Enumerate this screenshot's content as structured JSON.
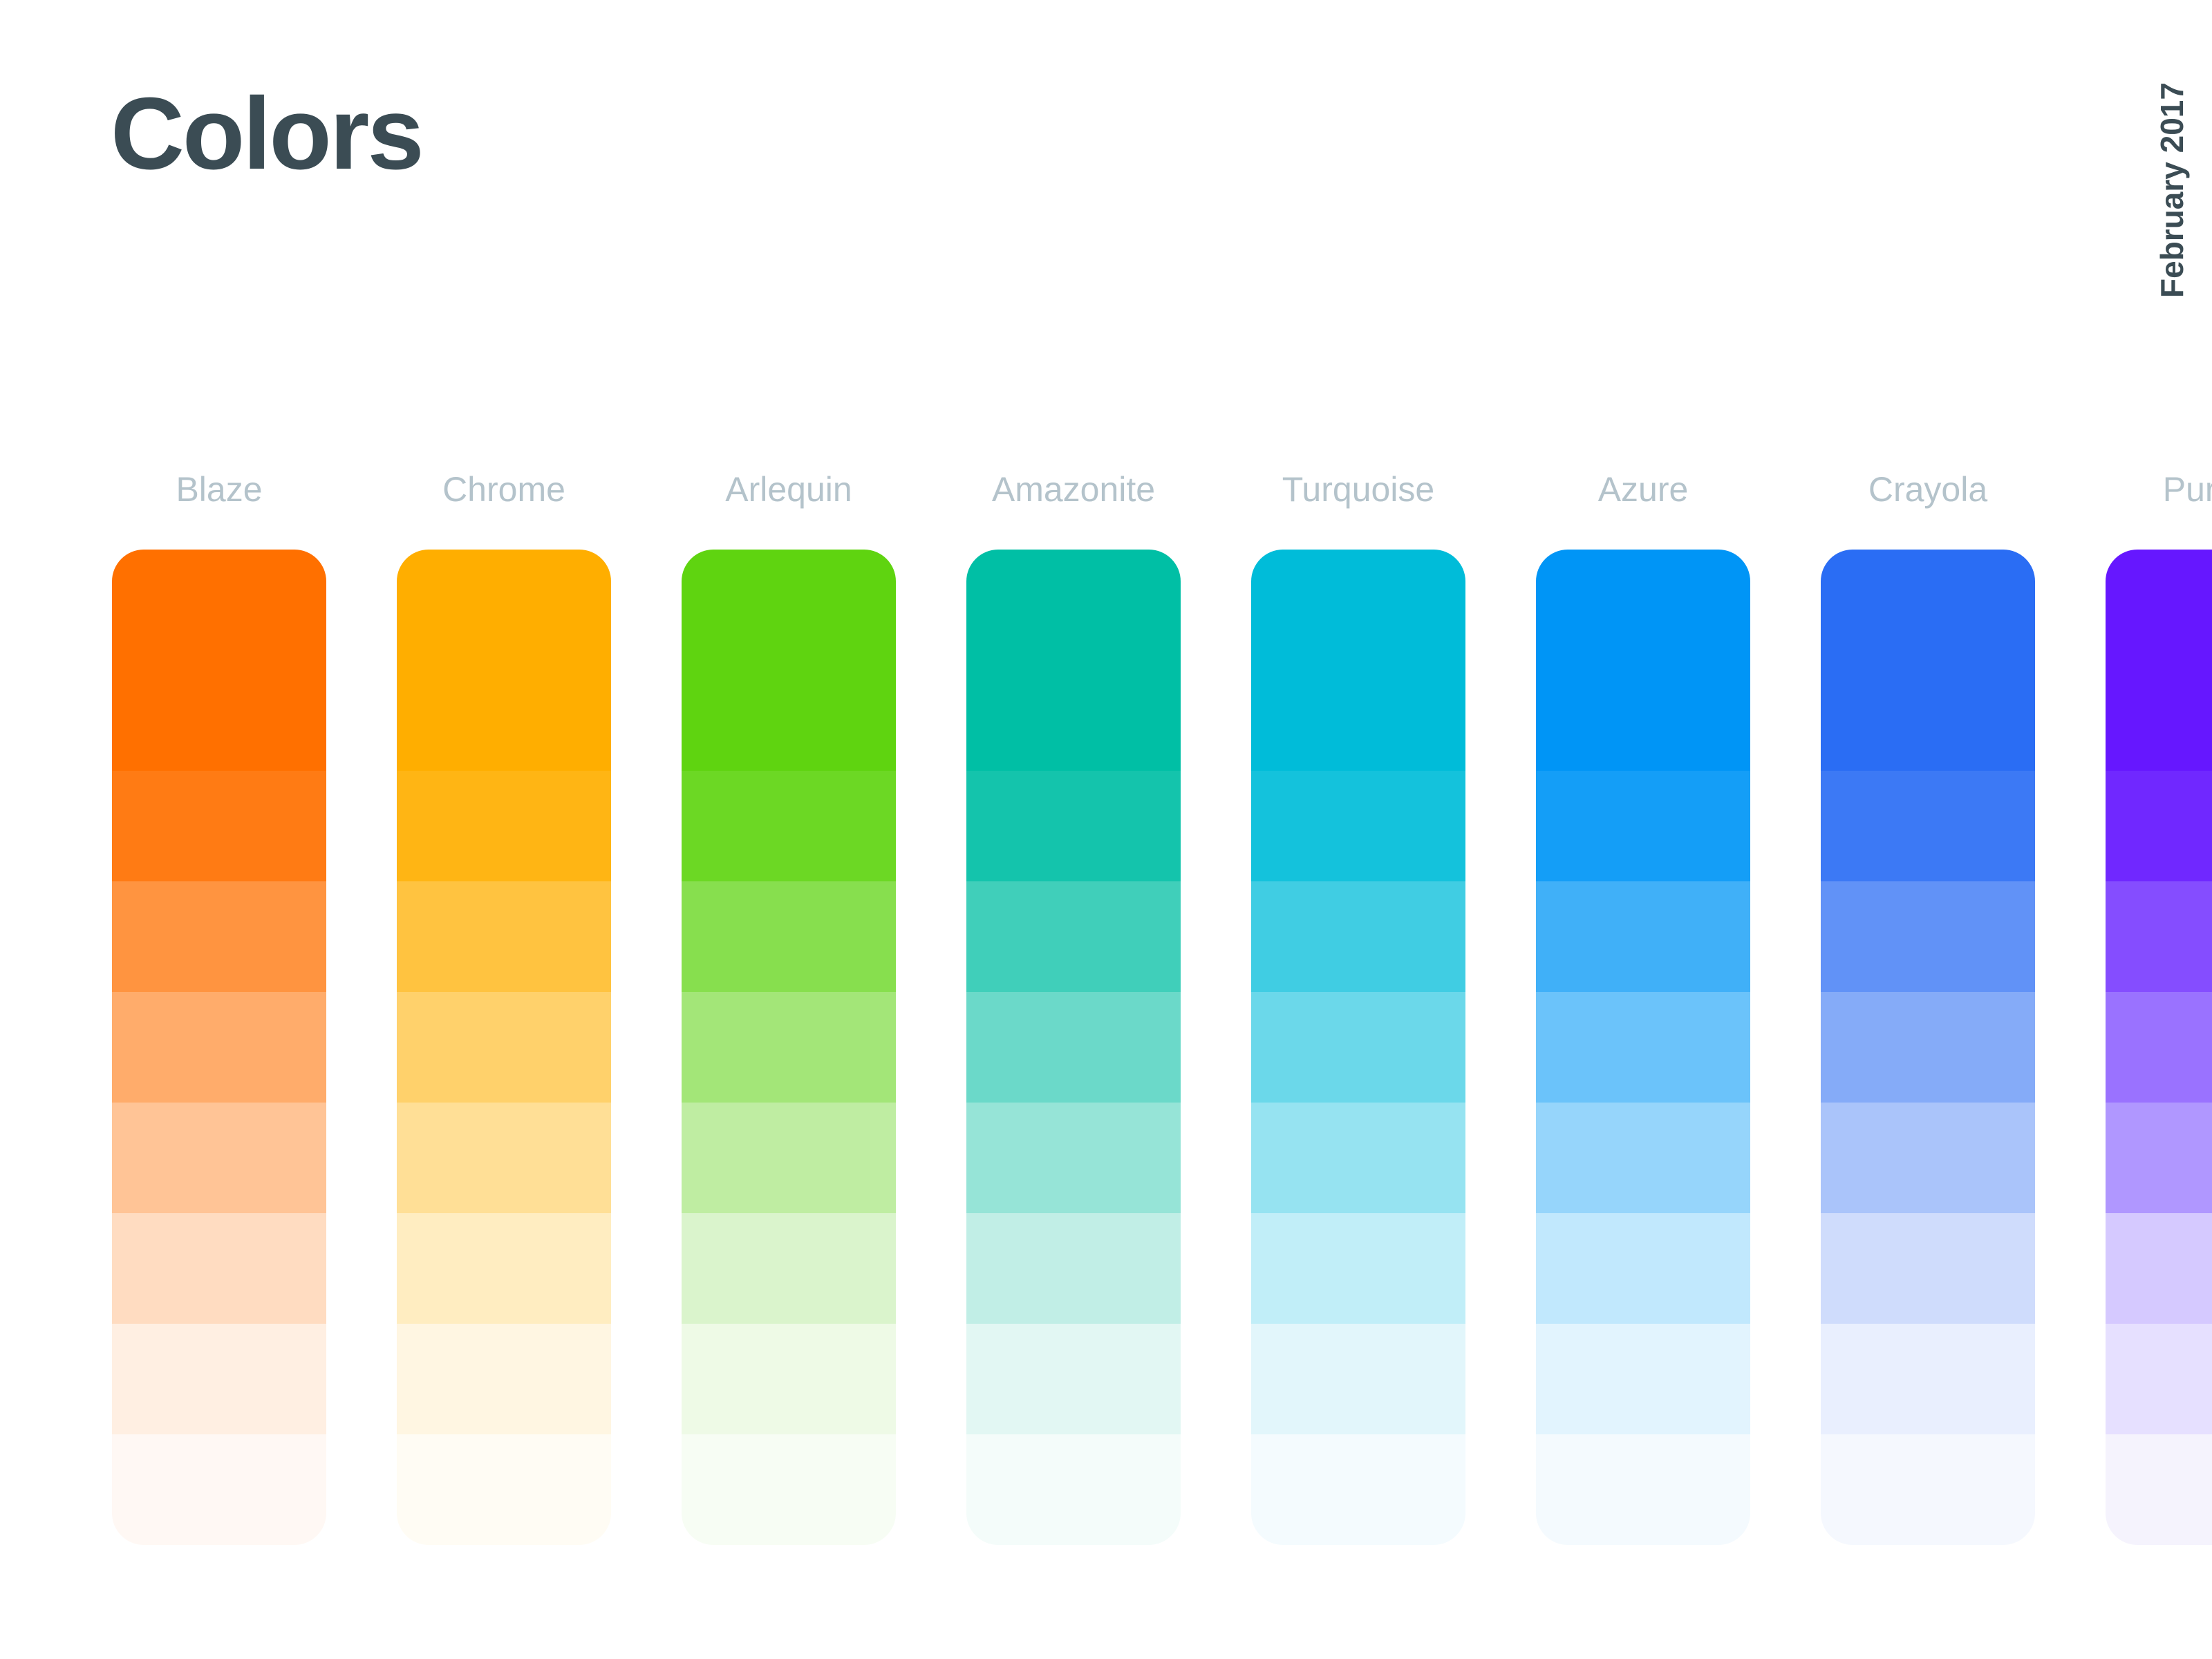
{
  "header": {
    "title": "Colors",
    "date": "February 2017",
    "title_color": "#3b4c54",
    "label_color": "#b4c3cb",
    "background": "#ffffff"
  },
  "palette": {
    "columns": [
      {
        "name": "Blaze",
        "base": "#ff7000",
        "swatches": [
          "#ff7000",
          "#ff7b14",
          "#ff9440",
          "#ffac6b",
          "#ffc496",
          "#ffdcc1",
          "#ffefe2",
          "#fff8f4"
        ]
      },
      {
        "name": "Chrome",
        "base": "#ffae00",
        "swatches": [
          "#ffae00",
          "#ffb514",
          "#ffc340",
          "#ffd16b",
          "#ffdf96",
          "#ffedc1",
          "#fff6e2",
          "#fffcf4"
        ]
      },
      {
        "name": "Arlequin",
        "base": "#5fd410",
        "swatches": [
          "#5fd410",
          "#6cd824",
          "#87df4e",
          "#a3e678",
          "#bfeda2",
          "#daf4cc",
          "#eefae6",
          "#f7fdf4"
        ]
      },
      {
        "name": "Amazonite",
        "base": "#00bfa5",
        "swatches": [
          "#00bfa5",
          "#14c4ac",
          "#40cfba",
          "#6bd9c9",
          "#96e4d7",
          "#c1eee6",
          "#e2f7f3",
          "#f4fcfa"
        ]
      },
      {
        "name": "Turquoise",
        "base": "#00bcd9",
        "swatches": [
          "#00bcd9",
          "#14c2dc",
          "#40cde3",
          "#6bd8ea",
          "#96e3f1",
          "#c1eef8",
          "#e2f6fb",
          "#f4fbfe"
        ]
      },
      {
        "name": "Azure",
        "base": "#0095f6",
        "swatches": [
          "#0095f6",
          "#149ef7",
          "#40b0f8",
          "#6bc3fa",
          "#96d5fb",
          "#c1e8fd",
          "#e2f4fe",
          "#f4fafe"
        ]
      },
      {
        "name": "Crayola",
        "base": "#2a6df4",
        "swatches": [
          "#2a6df4",
          "#3c79f5",
          "#6192f7",
          "#85abf8",
          "#aac4fa",
          "#cfdcfc",
          "#e9effe",
          "#f5f8fe"
        ]
      },
      {
        "name": "Purple",
        "base": "#6617ff",
        "swatches": [
          "#6617ff",
          "#7028ff",
          "#854dff",
          "#9a72ff",
          "#b097ff",
          "#d5c9ff",
          "#e6e0ff",
          "#f5f3fd"
        ]
      },
      {
        "name": "Pur",
        "base": "#6617ff",
        "swatches": [
          "#6617ff",
          "#7028ff",
          "#854dff",
          "#9a72ff",
          "#b097ff",
          "#d5c9ff",
          "#e6e0ff",
          "#f5f3fd"
        ]
      }
    ]
  }
}
